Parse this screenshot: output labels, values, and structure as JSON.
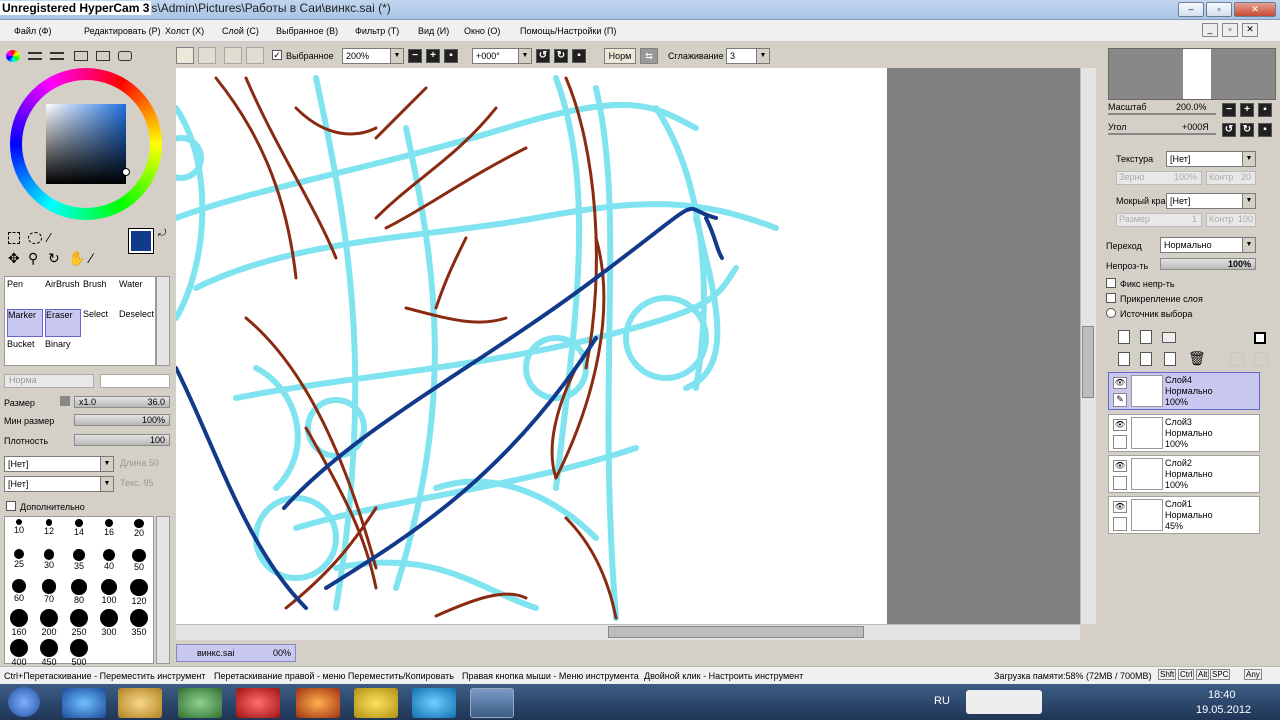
{
  "window": {
    "title": "Unregistered HyperCam 3",
    "path": "s\\Admin\\Pictures\\Работы в Саи\\винкс.sai (*)",
    "min": "–",
    "max": "▫",
    "close": "✕"
  },
  "menu": [
    {
      "label": "Файл (Ф)"
    },
    {
      "label": "Редактировать (Р)"
    },
    {
      "label": "Холст (Х)"
    },
    {
      "label": "Слой (С)"
    },
    {
      "label": "Выбранное (В)"
    },
    {
      "label": "Фильтр (Т)"
    },
    {
      "label": "Вид (И)"
    },
    {
      "label": "Окно (О)"
    },
    {
      "label": "Помощь/Настройки (П)"
    }
  ],
  "toolbar": {
    "selected_label": "Выбранное",
    "zoom": "200%",
    "angle": "+000°",
    "normal_btn": "Норм",
    "smoothing_label": "Сглаживание",
    "smoothing_value": "3"
  },
  "tools": [
    {
      "label": "Pen"
    },
    {
      "label": "AirBrush"
    },
    {
      "label": "Brush"
    },
    {
      "label": "Water"
    },
    {
      "label": "Marker"
    },
    {
      "label": "Eraser"
    },
    {
      "label": "Select"
    },
    {
      "label": "Deselect"
    },
    {
      "label": "Bucket"
    },
    {
      "label": "Binary"
    }
  ],
  "brush_settings": {
    "mode": "Норма",
    "size_label": "Размер",
    "size_mult": "x1.0",
    "size_value": "36.0",
    "min_size_label": "Мин размер",
    "min_size_value": "100%",
    "density_label": "Плотность",
    "density_value": "100",
    "texture1": "[Нет]",
    "texture1_right": "Длина 50",
    "texture2": "[Нет]",
    "texture2_right": "Текс. 95",
    "advanced_label": "Дополнительно"
  },
  "brush_sizes": [
    "10",
    "12",
    "14",
    "16",
    "20",
    "25",
    "30",
    "35",
    "40",
    "50",
    "60",
    "70",
    "80",
    "100",
    "120",
    "160",
    "200",
    "250",
    "300",
    "350",
    "400",
    "450",
    "500"
  ],
  "colors": {
    "primary": "#123a8a",
    "secondary": "#ffffff",
    "accent_cyan": "#7fe3f0",
    "stroke_brown": "#8a2a10",
    "stroke_blue": "#123a8a"
  },
  "navigator": {
    "zoom_label": "Масштаб",
    "zoom_value": "200.0%",
    "angle_label": "Угол",
    "angle_value": "+000Я"
  },
  "layer_props": {
    "texture_label": "Текстура",
    "texture_value": "[Нет]",
    "grain_label": "Зерно",
    "grain_value": "100%",
    "contrast_label": "Контр",
    "contrast_value": "20",
    "wet_label": "Мокрый край",
    "wet_value": "[Нет]",
    "size_label": "Размер",
    "size_value": "1",
    "contr2_label": "Контр",
    "contr2_value": "100",
    "blend_label": "Переход",
    "blend_value": "Нормально",
    "opacity_label": "Непроз-ть",
    "opacity_value": "100%",
    "opt1": "Фикс непр-ть",
    "opt2": "Прикрепление слоя",
    "opt3": "Источник выбора"
  },
  "layers": [
    {
      "name": "Слой4",
      "mode": "Нормально",
      "opacity": "100%"
    },
    {
      "name": "Слой3",
      "mode": "Нормально",
      "opacity": "100%"
    },
    {
      "name": "Слой2",
      "mode": "Нормально",
      "opacity": "100%"
    },
    {
      "name": "Слой1",
      "mode": "Нормально",
      "opacity": "45%"
    }
  ],
  "doc_tab": {
    "name": "винкс.sai",
    "progress": "00%"
  },
  "status": {
    "hint1": "Ctrl+Перетаскивание - Переместить инструмент",
    "hint2": "Перетаскивание правой - меню Переместить/Копировать",
    "hint3": "Правая кнопка мыши - Меню инструмента",
    "hint4": "Двойной клик - Настроить инструмент",
    "memory": "Загрузка памяти:58% (72MB / 700MB)",
    "keys": [
      "Shft",
      "Ctrl",
      "Alt",
      "SPC",
      "Any"
    ]
  },
  "taskbar": {
    "lang": "RU",
    "time": "18:40",
    "date": "19.05.2012"
  }
}
